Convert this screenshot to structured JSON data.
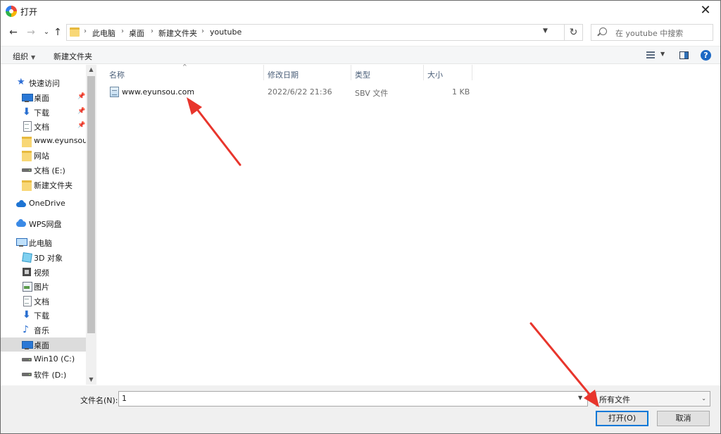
{
  "window": {
    "title": "打开",
    "close_glyph": "✕"
  },
  "nav": {
    "back_glyph": "←",
    "forward_glyph": "→",
    "recent_glyph": "⌄",
    "up_glyph": "↑",
    "breadcrumb": [
      "此电脑",
      "桌面",
      "新建文件夹",
      "youtube"
    ],
    "search_placeholder": "在 youtube 中搜索"
  },
  "toolbar": {
    "organize": "组织",
    "new_folder": "新建文件夹"
  },
  "sidebar": {
    "items": [
      {
        "label": "快速访问",
        "icon": "star-icon"
      },
      {
        "label": "桌面",
        "icon": "desktop-icon",
        "pinned": true
      },
      {
        "label": "下载",
        "icon": "download-icon",
        "pinned": true
      },
      {
        "label": "文档",
        "icon": "document-icon",
        "pinned": true
      },
      {
        "label": "www.eyunsou.c",
        "icon": "folder-icon"
      },
      {
        "label": "网站",
        "icon": "folder-icon"
      },
      {
        "label": "文档 (E:)",
        "icon": "drive-icon"
      },
      {
        "label": "新建文件夹",
        "icon": "folder-icon"
      },
      {
        "label": "OneDrive",
        "icon": "onedrive-icon"
      },
      {
        "label": "WPS网盘",
        "icon": "wps-cloud-icon"
      },
      {
        "label": "此电脑",
        "icon": "this-pc-icon"
      },
      {
        "label": "3D 对象",
        "icon": "3d-objects-icon"
      },
      {
        "label": "视频",
        "icon": "video-icon"
      },
      {
        "label": "图片",
        "icon": "pictures-icon"
      },
      {
        "label": "文档",
        "icon": "document-icon"
      },
      {
        "label": "下载",
        "icon": "download-icon"
      },
      {
        "label": "音乐",
        "icon": "music-icon"
      },
      {
        "label": "桌面",
        "icon": "desktop-icon",
        "selected": true
      },
      {
        "label": "Win10 (C:)",
        "icon": "drive-icon"
      },
      {
        "label": "软件 (D:)",
        "icon": "drive-icon"
      }
    ]
  },
  "filelist": {
    "columns": [
      "名称",
      "修改日期",
      "类型",
      "大小"
    ],
    "rows": [
      {
        "name": "www.eyunsou.com",
        "modified": "2022/6/22 21:36",
        "type": "SBV 文件",
        "size": "1 KB"
      }
    ]
  },
  "bottom": {
    "filename_label": "文件名(N):",
    "filename_value": "1",
    "filetype_value": "所有文件",
    "open_button": "打开(O)",
    "cancel_button": "取消"
  },
  "colors": {
    "accent": "#0078d7",
    "annotation_arrow": "#e8352c"
  }
}
